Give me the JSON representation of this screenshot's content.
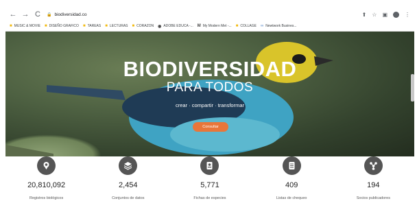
{
  "browser": {
    "url": "biodiversidad.co",
    "back": "←",
    "forward": "→",
    "reload": "C"
  },
  "bookmarks": [
    {
      "label": "MUSIC & MOVIE",
      "icon": "folder-icon"
    },
    {
      "label": "DISEÑO GRAFICO",
      "icon": "folder-icon"
    },
    {
      "label": "TAREAS",
      "icon": "folder-icon"
    },
    {
      "label": "LECTURAS",
      "icon": "folder-icon"
    },
    {
      "label": "CORAZON",
      "icon": "folder-icon"
    },
    {
      "label": "ADOBE EDUCA -...",
      "icon": "adobe-icon"
    },
    {
      "label": "My Modern Met -...",
      "icon": "mymodernmet-icon"
    },
    {
      "label": "COLLAGE",
      "icon": "folder-icon"
    },
    {
      "label": "Newtwork Busines...",
      "icon": "network-icon"
    }
  ],
  "hero": {
    "title": "BIODIVERSIDAD",
    "subtitle": "PARA TODOS",
    "tagline": "crear · compartir · transformar",
    "button": "Consultar"
  },
  "stats": [
    {
      "value": "20,810,092",
      "label": "Registros biológicos",
      "icon": "pin-icon"
    },
    {
      "value": "2,454",
      "label": "Conjuntos de datos",
      "icon": "layers-icon"
    },
    {
      "value": "5,771",
      "label": "Fichas de especies",
      "icon": "species-card-icon"
    },
    {
      "value": "409",
      "label": "Listas de chequeo",
      "icon": "checklist-icon"
    },
    {
      "value": "194",
      "label": "Socios publicadores",
      "icon": "network-nodes-icon"
    }
  ],
  "colors": {
    "accent": "#e8763a",
    "stat_icon": "#555555"
  }
}
